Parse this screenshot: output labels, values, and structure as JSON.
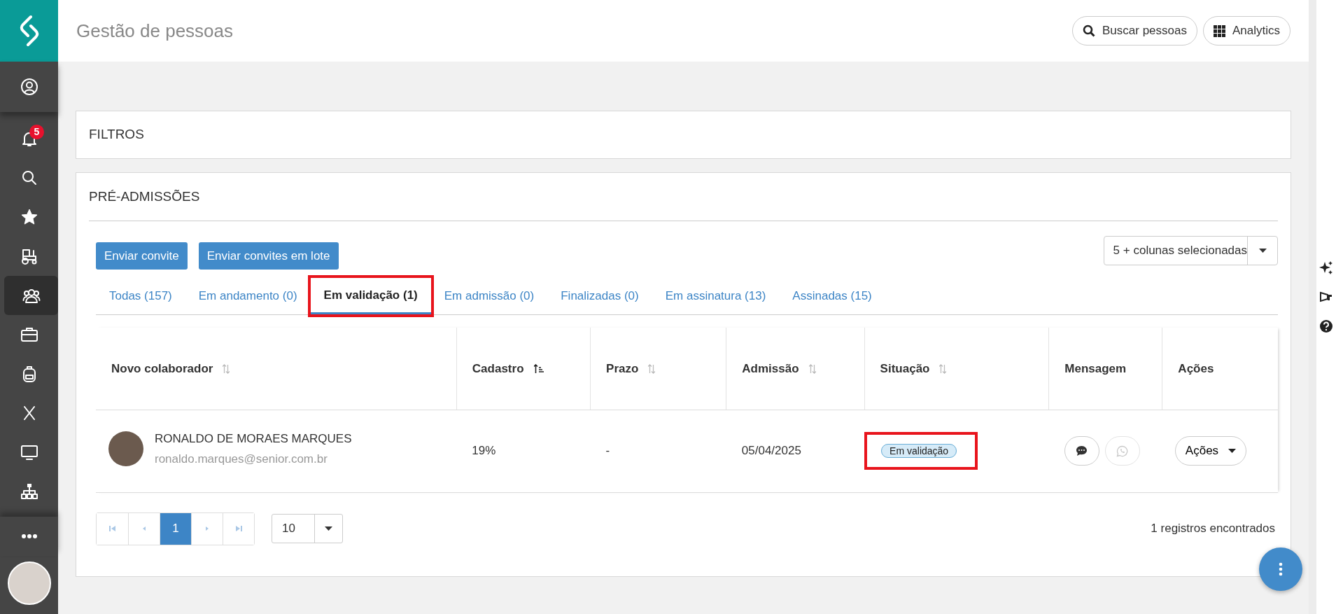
{
  "sidebar": {
    "items": [
      {
        "kind": "user",
        "selected": false
      },
      {
        "kind": "bell",
        "selected": false,
        "badge": "5"
      },
      {
        "kind": "search",
        "selected": false
      },
      {
        "kind": "star",
        "selected": false
      },
      {
        "kind": "tractor",
        "selected": false
      },
      {
        "kind": "team",
        "selected": true
      },
      {
        "kind": "briefcase",
        "selected": false
      },
      {
        "kind": "backpack",
        "selected": false
      },
      {
        "kind": "cross",
        "selected": false
      },
      {
        "kind": "monitor",
        "selected": false
      },
      {
        "kind": "org",
        "selected": false
      },
      {
        "kind": "dots",
        "selected": false
      }
    ]
  },
  "header": {
    "title": "Gestão de pessoas",
    "buttons": [
      {
        "label": "Buscar pessoas",
        "kind": "search"
      },
      {
        "label": "Analytics",
        "kind": "grid"
      }
    ]
  },
  "filters": {
    "title": "FILTROS"
  },
  "pre_admissions": {
    "title": "PRÉ-ADMISSÕES",
    "buttons": [
      "Enviar convite",
      "Enviar convites em lote"
    ],
    "columns_select": "5 + colunas selecionadas",
    "tabs": [
      {
        "label": "Todas (157)",
        "selected": false,
        "highlighted": false
      },
      {
        "label": "Em andamento (0)",
        "selected": false,
        "highlighted": false
      },
      {
        "label": "Em validação (1)",
        "selected": true,
        "highlighted": true
      },
      {
        "label": "Em admissão (0)",
        "selected": false,
        "highlighted": false
      },
      {
        "label": "Finalizadas (0)",
        "selected": false,
        "highlighted": false
      },
      {
        "label": "Em assinatura (13)",
        "selected": false,
        "highlighted": false
      },
      {
        "label": "Assinadas (15)",
        "selected": false,
        "highlighted": false
      }
    ],
    "table": {
      "columns": [
        {
          "label": "Novo colaborador",
          "kind": "sortable"
        },
        {
          "label": "Cadastro",
          "kind": "sorted"
        },
        {
          "label": "Prazo",
          "kind": "sortable"
        },
        {
          "label": "Admissão",
          "kind": "sortable"
        },
        {
          "label": "Situação",
          "kind": "sortable"
        },
        {
          "label": "Mensagem",
          "kind": "plain"
        },
        {
          "label": "Ações",
          "kind": "plain"
        }
      ],
      "rows": [
        {
          "name": "RONALDO DE MORAES MARQUES",
          "email": "ronaldo.marques@senior.com.br",
          "cadastro": "19%",
          "prazo": "-",
          "admissao": "05/04/2025",
          "situacao": "Em validação",
          "situacao_highlighted": true,
          "messages": [
            {
              "kind": "chat",
              "disabled": false
            },
            {
              "kind": "whatsapp",
              "disabled": true
            }
          ],
          "actions": "Ações"
        }
      ]
    },
    "pagination": {
      "pages": [
        {
          "label": "1",
          "selected": true
        }
      ],
      "page_size": "10",
      "records": "1 registros encontrados"
    }
  },
  "right_rail": [
    {
      "kind": "sparkle"
    },
    {
      "kind": "megaphone"
    },
    {
      "kind": "help"
    }
  ]
}
